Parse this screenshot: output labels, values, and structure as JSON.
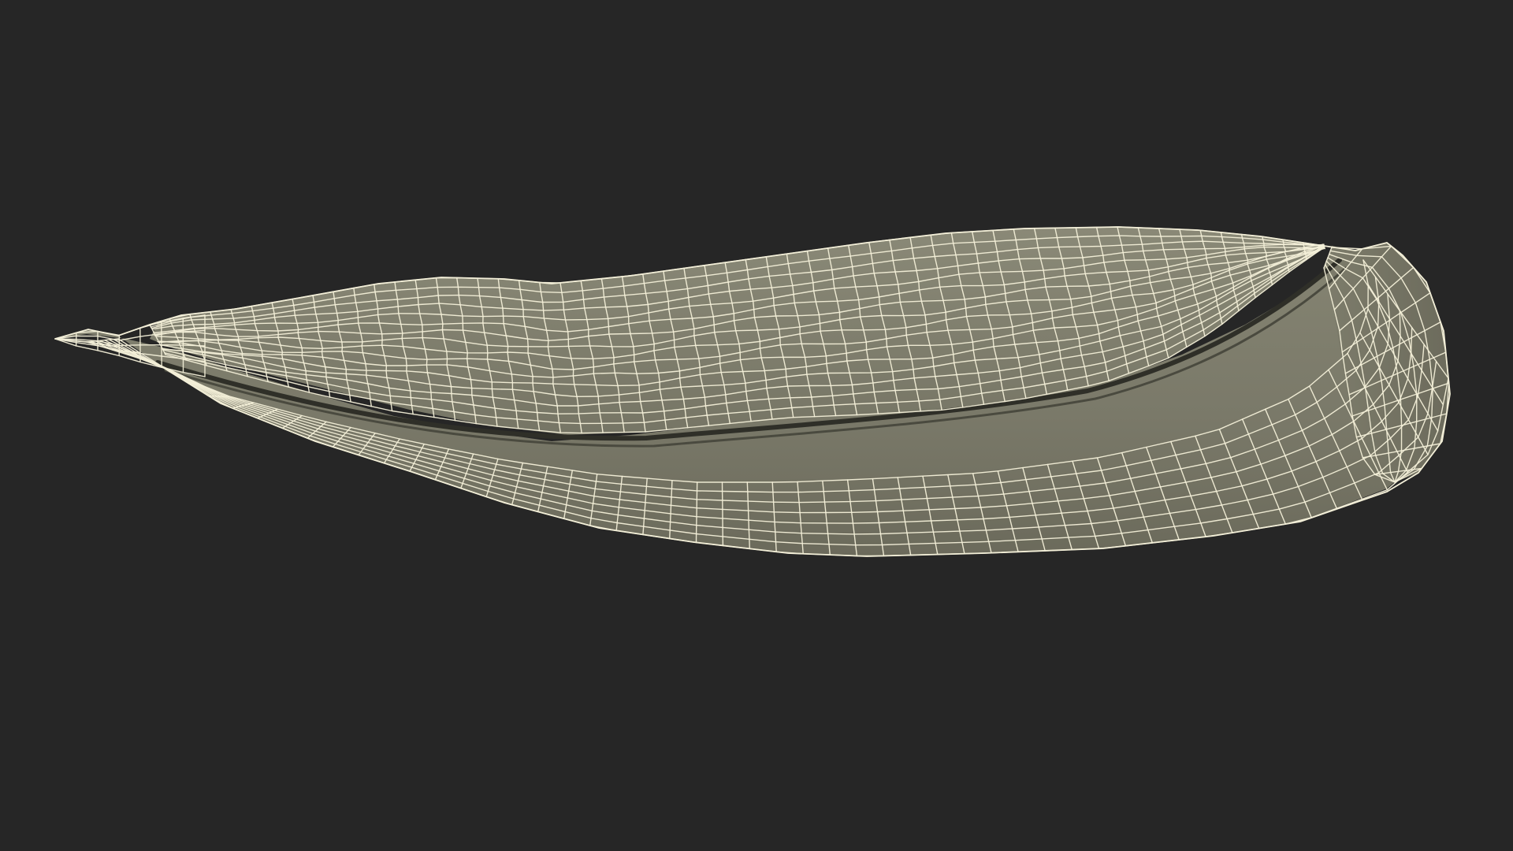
{
  "scene": {
    "background_color": "#262626",
    "model_name": "",
    "shading_mode": "wireframe-on-shaded"
  },
  "materials": {
    "surface_color": "#7c7b6b",
    "surface_dark": "#6f6e5f",
    "surface_light": "#8a8977",
    "crease_color": "#2f2f28",
    "wire_color": "#f3efd8"
  },
  "mesh": {
    "body_ring_count": 22,
    "body_segment_count": 56,
    "lid_ring_count": 16,
    "lid_segment_count": 58,
    "wire_icon": "wireframe-grid"
  }
}
